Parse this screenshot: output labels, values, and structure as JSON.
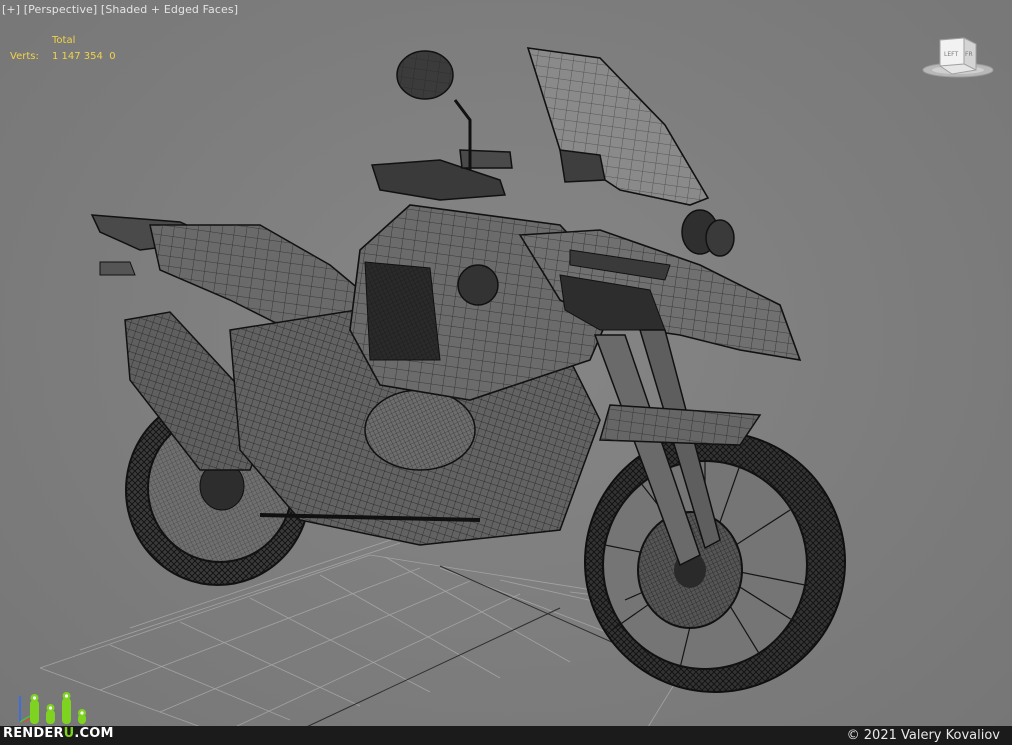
{
  "viewport": {
    "menu_plus": "[+]",
    "view_mode": "[Perspective]",
    "shading_mode": "[Shaded + Edged Faces]"
  },
  "stats": {
    "header": "Total",
    "verts_label": "Verts:",
    "verts_value": "1 147 354",
    "verts_selected": "0"
  },
  "viewcube": {
    "left_face": "LEFT",
    "front_face": "FR"
  },
  "footer": {
    "logo_main": "RENDER",
    "logo_accent": "U",
    "logo_suffix": ".COM",
    "copyright": "© 2021 Valery Kovaliov"
  },
  "colors": {
    "viewport_bg": "#7e7e7e",
    "stats_text": "#f0d34a",
    "logo_accent": "#7ed321",
    "wire": "#1a1a1a"
  }
}
